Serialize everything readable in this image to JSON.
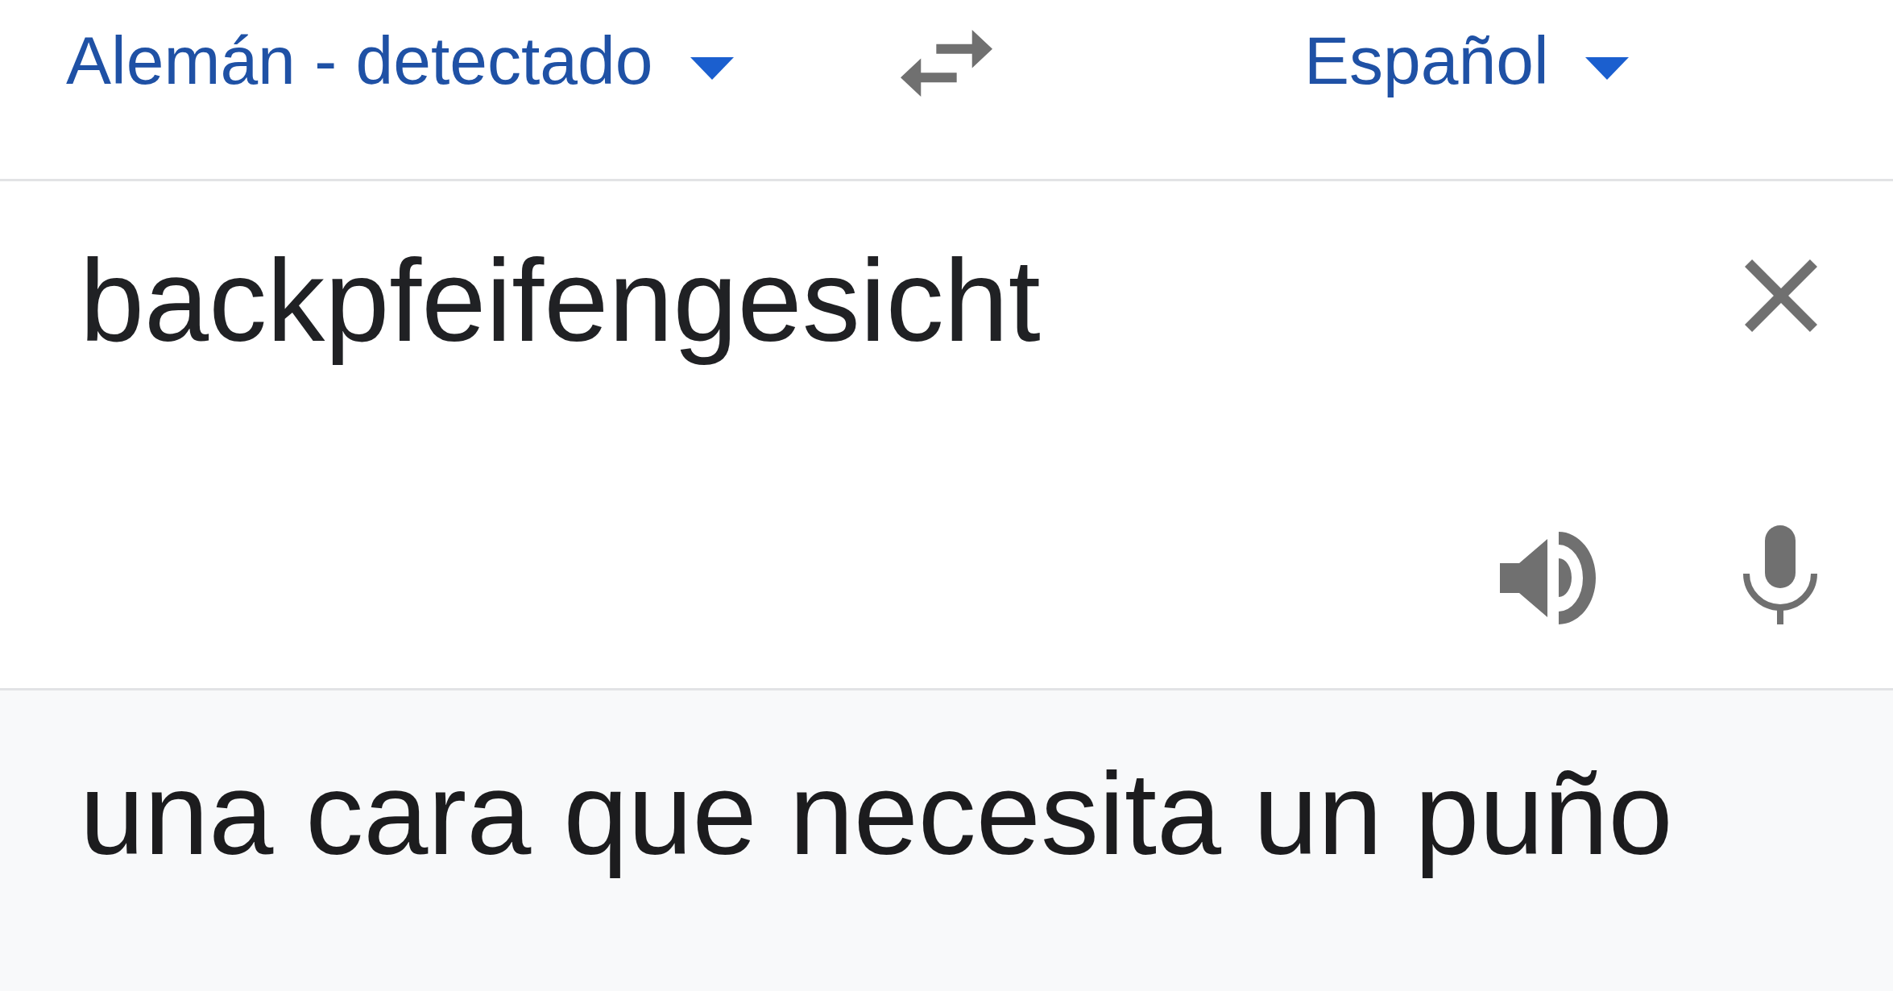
{
  "language_bar": {
    "source_language": {
      "label": "Alemán - detectado"
    },
    "target_language": {
      "label": "Español"
    }
  },
  "input": {
    "value": "backpfeifengesicht"
  },
  "output": {
    "text": "una cara que necesita un puño"
  }
}
